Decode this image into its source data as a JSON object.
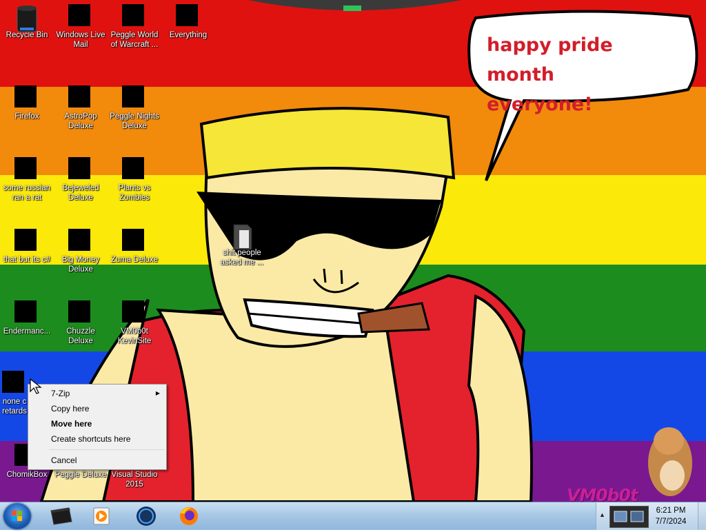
{
  "desktop": {
    "speech_bubble_text_line1": "happy pride month",
    "speech_bubble_text_line2": "everyone!",
    "watermark": "VM0b0t",
    "rainbow_colors": [
      "#e0120f",
      "#f28a0c",
      "#fbe90a",
      "#1c8c1e",
      "#1448e6",
      "#7a1890"
    ],
    "icons": [
      {
        "label": "Recycle Bin",
        "icon": "recycle-bin-icon"
      },
      {
        "label": "Windows Live Mail",
        "icon": "mail-icon"
      },
      {
        "label": "Peggle World of Warcraft ...",
        "icon": "peggle-wow-icon"
      },
      {
        "label": "Everything",
        "icon": "search-everything-icon"
      },
      {
        "label": "Firefox",
        "icon": "firefox-icon"
      },
      {
        "label": "AstroPop Deluxe",
        "icon": "astropop-icon"
      },
      {
        "label": "Peggle Nights Deluxe",
        "icon": "peggle-nights-icon"
      },
      {
        "label": "some russian ran a rat",
        "icon": "russian-app-icon"
      },
      {
        "label": "Bejeweled Deluxe",
        "icon": "bejeweled-icon"
      },
      {
        "label": "Plants vs Zombies",
        "icon": "plants-vs-zombies-icon"
      },
      {
        "label": "that but its c#",
        "icon": "shortcut-icon"
      },
      {
        "label": "Big Money Deluxe",
        "icon": "big-money-icon"
      },
      {
        "label": "Zuma Deluxe",
        "icon": "zuma-icon"
      },
      {
        "label": "Endermanc...",
        "icon": "terminal-icon"
      },
      {
        "label": "Chuzzle Deluxe",
        "icon": "chuzzle-icon"
      },
      {
        "label": "VM0b0t KevinSite",
        "icon": "vs-project-icon"
      },
      {
        "label": "none c",
        "label2": "retards",
        "icon": "app-icon"
      },
      {
        "label": "ChomikBox",
        "icon": "chomikbox-icon"
      },
      {
        "label": "Peggle Deluxe",
        "icon": "peggle-icon"
      },
      {
        "label": "Visual Studio 2015",
        "icon": "visual-studio-icon"
      },
      {
        "label": "shit people asked me ...",
        "icon": "folder-icon"
      }
    ]
  },
  "context_menu": {
    "items": [
      {
        "label": "7-Zip",
        "submenu": true
      },
      {
        "label": "Copy here"
      },
      {
        "label": "Move here",
        "bold": true
      },
      {
        "label": "Create shortcuts here"
      },
      {
        "label": "Cancel"
      }
    ]
  },
  "taskbar": {
    "apps": [
      "terminal-icon",
      "media-player-icon",
      "globe-icon",
      "firefox-icon"
    ],
    "clock_time": "6:21 PM",
    "clock_date": "7/7/2024"
  }
}
